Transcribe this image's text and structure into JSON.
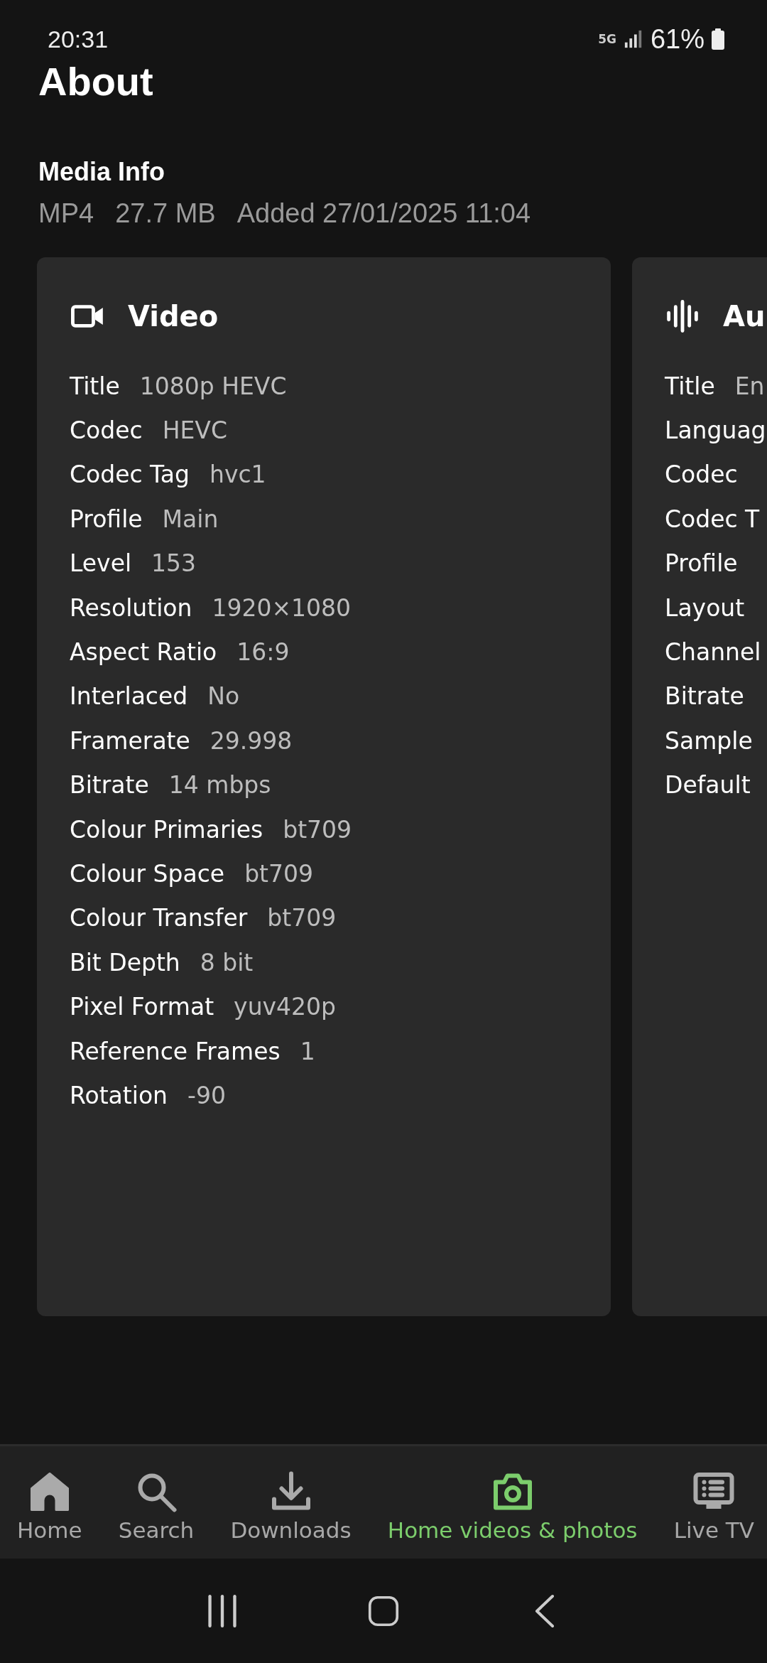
{
  "status_bar": {
    "time": "20:31",
    "network": "5G",
    "battery": "61%"
  },
  "title": "About",
  "media_info": {
    "heading": "Media Info",
    "details": [
      "MP4",
      "27.7 MB",
      "Added 27/01/2025 11:04"
    ]
  },
  "streams": [
    {
      "kind": "video",
      "title": "Video",
      "rows": [
        {
          "label": "Title",
          "value": "1080p HEVC"
        },
        {
          "label": "Codec",
          "value": "HEVC"
        },
        {
          "label": "Codec Tag",
          "value": "hvc1"
        },
        {
          "label": "Profile",
          "value": "Main"
        },
        {
          "label": "Level",
          "value": "153"
        },
        {
          "label": "Resolution",
          "value": "1920×1080"
        },
        {
          "label": "Aspect Ratio",
          "value": "16:9"
        },
        {
          "label": "Interlaced",
          "value": "No"
        },
        {
          "label": "Framerate",
          "value": "29.998"
        },
        {
          "label": "Bitrate",
          "value": "14 mbps"
        },
        {
          "label": "Colour Primaries",
          "value": "bt709"
        },
        {
          "label": "Colour Space",
          "value": "bt709"
        },
        {
          "label": "Colour Transfer",
          "value": "bt709"
        },
        {
          "label": "Bit Depth",
          "value": "8 bit"
        },
        {
          "label": "Pixel Format",
          "value": "yuv420p"
        },
        {
          "label": "Reference Frames",
          "value": "1"
        },
        {
          "label": "Rotation",
          "value": "-90"
        }
      ]
    },
    {
      "kind": "audio",
      "title": "Au",
      "rows": [
        {
          "label": "Title",
          "value": "En"
        },
        {
          "label": "Languag"
        },
        {
          "label": "Codec"
        },
        {
          "label": "Codec T"
        },
        {
          "label": "Profile"
        },
        {
          "label": "Layout"
        },
        {
          "label": "Channel"
        },
        {
          "label": "Bitrate"
        },
        {
          "label": "Sample"
        },
        {
          "label": "Default"
        }
      ]
    }
  ],
  "bottom_nav": [
    {
      "kind": "home",
      "label": "Home",
      "selected": false
    },
    {
      "kind": "search",
      "label": "Search",
      "selected": false
    },
    {
      "kind": "downloads",
      "label": "Downloads",
      "selected": false
    },
    {
      "kind": "camera",
      "label": "Home videos & photos",
      "selected": true
    },
    {
      "kind": "tv",
      "label": "Live TV",
      "selected": false
    }
  ]
}
